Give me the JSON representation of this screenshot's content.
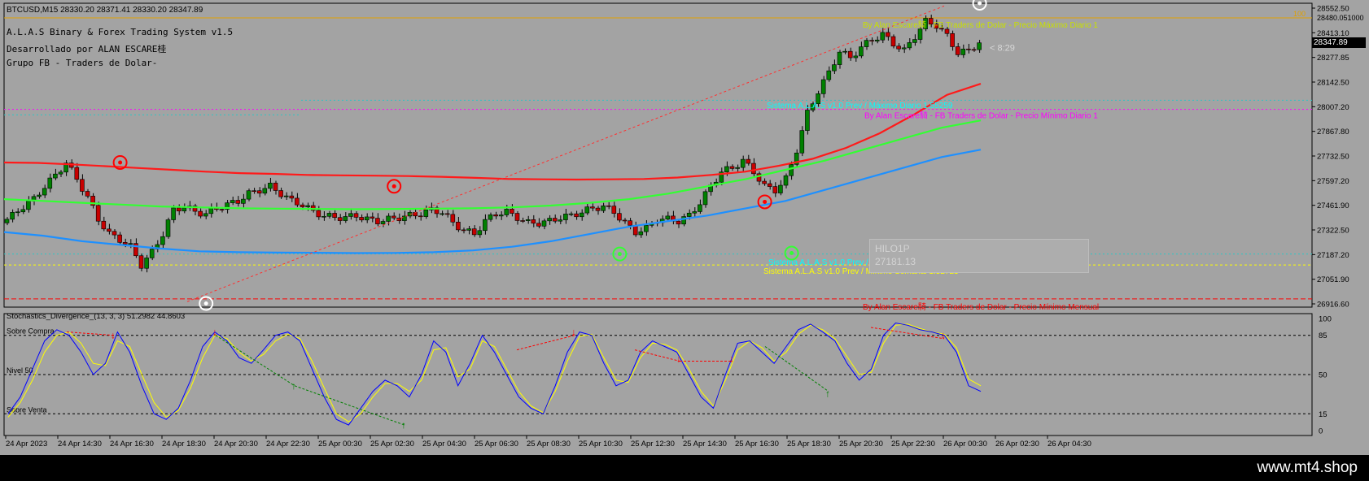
{
  "header": {
    "symbol_line": "BTCUSD,M15  28330.20 28371.41 28330.20 28347.89",
    "price_hint": "28480.051000",
    "title": "A.L.A.S Binary & Forex Trading System v1.5",
    "developer": "Desarrollado por ALAN ESCARE桂",
    "group": "Grupo FB - Traders de Dolar-"
  },
  "current_price_tag": "28347.89",
  "countdown": "< 8:29",
  "hilo": {
    "label": "HILO1P",
    "value": "27181.13"
  },
  "level_labels": [
    {
      "text": "By Alan Escare騎 - FB Traders de Dolar - Precio Máximo Diario 1",
      "color": "#c8e000",
      "price": 28480
    },
    {
      "text": "Sistema A.L.A.S v1.0 Prev / Máximo Diario 1.55259",
      "color": "#00ffff",
      "price": 28040
    },
    {
      "text": "By Alan Escare騎 - FB Traders de Dolar - Precio Mínimo Diario 1",
      "color": "#ff00ff",
      "price": 27985
    },
    {
      "text": "Sistema A.L.A.S v1.0 Prev / Mínimo Diario 1.54766",
      "color": "#00ffff",
      "price": 27180
    },
    {
      "text": "Sistema A.L.A.S v1.0 Prev / Mínimo Semanal 1.52723",
      "color": "#ffff00",
      "price": 27130
    },
    {
      "text": "By Alan Escare騎 - FB Traders de Dolar - Precio Mínimo Mensual",
      "color": "#ff0000",
      "price": 26940
    }
  ],
  "level_100_label": "100",
  "colors": {
    "background": "#a3a3a3",
    "bull_candle": "#008000",
    "bear_candle": "#c80000",
    "ma_red": "#ff1a1a",
    "ma_green": "#33ff33",
    "ma_blue": "#1e90ff",
    "stoch_main": "#0000ff",
    "stoch_signal": "#ffff00"
  },
  "chart_data": [
    {
      "type": "candlestick",
      "symbol": "BTCUSD",
      "timeframe": "M15",
      "price_axis": [
        "28552.50",
        "28413.10",
        "28277.85",
        "28142.50",
        "28007.20",
        "27867.80",
        "27732.50",
        "27597.20",
        "27461.90",
        "27322.50",
        "27187.20",
        "27051.90",
        "26916.60"
      ],
      "ylim": [
        26900,
        28560
      ],
      "time_axis": [
        "24 Apr 2023",
        "24 Apr 14:30",
        "24 Apr 16:30",
        "24 Apr 18:30",
        "24 Apr 20:30",
        "24 Apr 22:30",
        "25 Apr 00:30",
        "25 Apr 02:30",
        "25 Apr 04:30",
        "25 Apr 06:30",
        "25 Apr 08:30",
        "25 Apr 10:30",
        "25 Apr 12:30",
        "25 Apr 14:30",
        "25 Apr 16:30",
        "25 Apr 18:30",
        "25 Apr 20:30",
        "25 Apr 22:30",
        "26 Apr 00:30",
        "26 Apr 02:30",
        "26 Apr 04:30"
      ],
      "close_path": [
        27360,
        27400,
        27450,
        27490,
        27560,
        27620,
        27690,
        27600,
        27500,
        27380,
        27300,
        27270,
        27230,
        27130,
        27200,
        27300,
        27430,
        27450,
        27420,
        27410,
        27440,
        27460,
        27480,
        27520,
        27540,
        27560,
        27520,
        27480,
        27460,
        27420,
        27400,
        27390,
        27390,
        27400,
        27380,
        27370,
        27380,
        27390,
        27400,
        27410,
        27430,
        27420,
        27360,
        27320,
        27300,
        27370,
        27410,
        27420,
        27390,
        27360,
        27360,
        27370,
        27390,
        27400,
        27420,
        27440,
        27450,
        27420,
        27360,
        27310,
        27330,
        27380,
        27380,
        27370,
        27400,
        27470,
        27560,
        27640,
        27660,
        27700,
        27640,
        27560,
        27540,
        27600,
        27760,
        27960,
        28080,
        28180,
        28300,
        28260,
        28320,
        28360,
        28390,
        28340,
        28300,
        28380,
        28460,
        28440,
        28380,
        28290,
        28300,
        28347
      ],
      "overlay_ma_red": [
        27690,
        27688,
        27680,
        27670,
        27660,
        27650,
        27640,
        27632,
        27628,
        27622,
        27620,
        27618,
        27616,
        27612,
        27606,
        27600,
        27598,
        27597,
        27598,
        27600,
        27608,
        27622,
        27640,
        27672,
        27710,
        27770,
        27850,
        27950,
        28060,
        28120
      ],
      "overlay_ma_green": [
        27490,
        27480,
        27470,
        27460,
        27450,
        27445,
        27440,
        27438,
        27436,
        27435,
        27436,
        27438,
        27440,
        27445,
        27455,
        27470,
        27490,
        27520,
        27560,
        27600,
        27650,
        27700,
        27760,
        27820,
        27880,
        27920
      ],
      "overlay_ma_blue": [
        27310,
        27290,
        27260,
        27240,
        27220,
        27205,
        27200,
        27198,
        27197,
        27195,
        27196,
        27200,
        27210,
        27230,
        27260,
        27300,
        27340,
        27370,
        27400,
        27440,
        27480,
        27540,
        27600,
        27660,
        27720,
        27760
      ],
      "markers": [
        {
          "type": "top",
          "price": 27690,
          "time_index": 21
        },
        {
          "type": "top",
          "price": 27560,
          "time_index": 72
        },
        {
          "type": "top",
          "price": 27475,
          "time_index": 141
        },
        {
          "type": "bottom",
          "price": 26920,
          "time_index": 37
        },
        {
          "type": "bottom",
          "price": 27190,
          "time_index": 114
        },
        {
          "type": "bottom",
          "price": 27195,
          "time_index": 146
        },
        {
          "type": "top",
          "price": 28560,
          "time_index": 195
        }
      ]
    },
    {
      "type": "line",
      "title": "Stochastics_Divergence_(13, 3, 3) 51.2982 44.8603",
      "ylim": [
        0,
        100
      ],
      "y_ticks": [
        "100",
        "85",
        "50",
        "15",
        "0"
      ],
      "levels": [
        {
          "value": 85,
          "label": "Sobre Compra"
        },
        {
          "value": 50,
          "label": "Nivel 50"
        },
        {
          "value": 15,
          "label": "Sobre Venta"
        }
      ],
      "series": [
        {
          "name": "Main",
          "values": [
            15,
            30,
            55,
            80,
            90,
            85,
            70,
            50,
            60,
            88,
            70,
            40,
            15,
            10,
            20,
            45,
            75,
            88,
            80,
            65,
            60,
            72,
            85,
            88,
            80,
            55,
            30,
            10,
            5,
            20,
            35,
            45,
            40,
            30,
            50,
            80,
            70,
            40,
            60,
            85,
            70,
            50,
            30,
            20,
            15,
            40,
            70,
            88,
            85,
            60,
            40,
            45,
            70,
            80,
            75,
            70,
            50,
            30,
            20,
            50,
            78,
            80,
            70,
            60,
            75,
            90,
            95,
            88,
            80,
            60,
            45,
            55,
            85,
            96,
            94,
            90,
            88,
            85,
            70,
            40,
            35
          ]
        },
        {
          "name": "Signal",
          "values": [
            12,
            25,
            45,
            70,
            85,
            88,
            78,
            60,
            58,
            80,
            75,
            50,
            25,
            12,
            18,
            38,
            65,
            85,
            82,
            70,
            62,
            68,
            80,
            86,
            82,
            62,
            38,
            15,
            8,
            15,
            30,
            42,
            42,
            35,
            45,
            72,
            74,
            48,
            55,
            80,
            75,
            55,
            35,
            22,
            16,
            35,
            62,
            84,
            86,
            65,
            45,
            43,
            65,
            78,
            77,
            72,
            55,
            35,
            22,
            45,
            72,
            80,
            74,
            62,
            70,
            86,
            94,
            90,
            82,
            66,
            50,
            52,
            78,
            94,
            95,
            91,
            88,
            86,
            74,
            46,
            40
          ]
        }
      ]
    }
  ]
}
